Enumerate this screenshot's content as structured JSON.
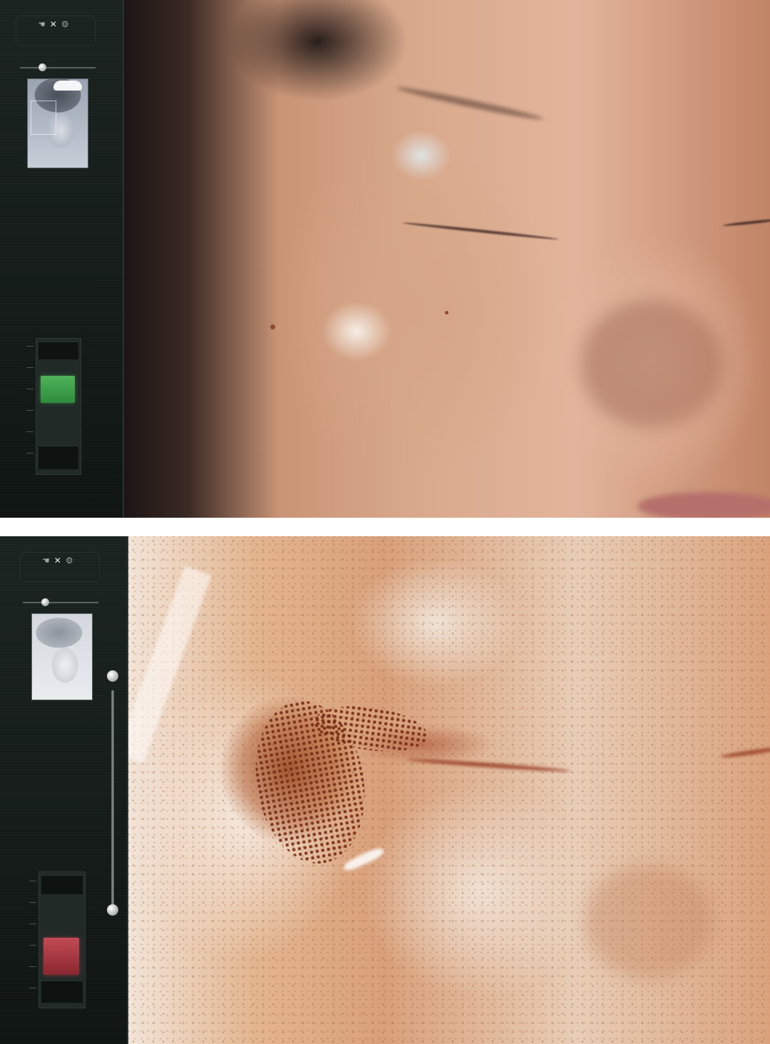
{
  "screens": [
    {
      "meter_color": "#3fa34d"
    },
    {
      "meter_color": "#a8323e"
    }
  ],
  "icons": [
    "hand-icon",
    "close-icon",
    "settings-icon"
  ],
  "colors": {
    "sidebar_bg": "#151c1a",
    "separator": "#ffffff"
  }
}
